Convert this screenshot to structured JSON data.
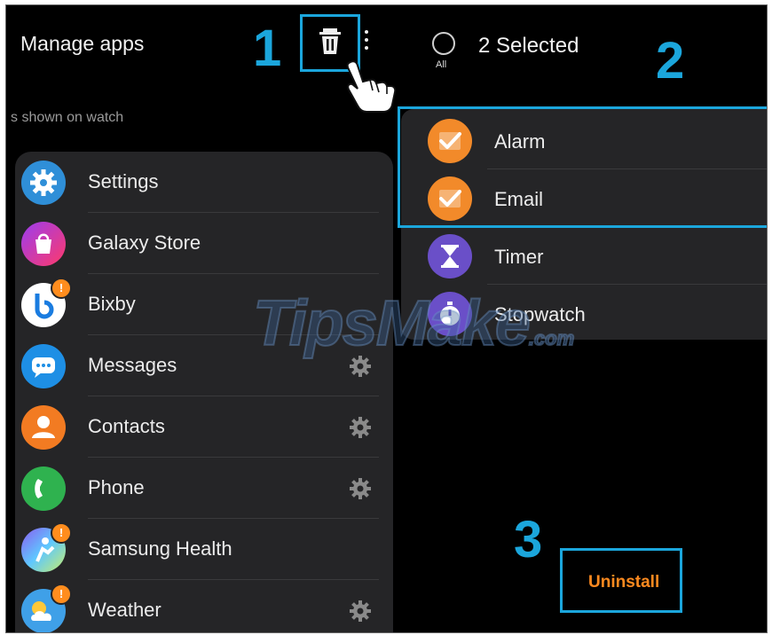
{
  "left_panel": {
    "title": "Manage apps",
    "subtitle": "s shown on watch",
    "apps": [
      {
        "name": "Settings",
        "icon": "settings-icon",
        "color": "#2f8fd8",
        "badge": "",
        "gear": false
      },
      {
        "name": "Galaxy Store",
        "icon": "galaxy-store-icon",
        "color": "#e8336b",
        "badge": "",
        "gear": false
      },
      {
        "name": "Bixby",
        "icon": "bixby-icon",
        "color": "#ffffff",
        "badge": "!",
        "gear": false
      },
      {
        "name": "Messages",
        "icon": "messages-icon",
        "color": "#1e8fe5",
        "badge": "",
        "gear": true
      },
      {
        "name": "Contacts",
        "icon": "contacts-icon",
        "color": "#f27b22",
        "badge": "",
        "gear": true
      },
      {
        "name": "Phone",
        "icon": "phone-icon",
        "color": "#2fb24f",
        "badge": "",
        "gear": true
      },
      {
        "name": "Samsung Health",
        "icon": "samsung-health-icon",
        "color": "#8fc6ff",
        "badge": "!",
        "gear": false
      },
      {
        "name": "Weather",
        "icon": "weather-icon",
        "color": "#3fa0e8",
        "badge": "!",
        "gear": true
      }
    ]
  },
  "right_panel": {
    "all_label": "All",
    "selected_text": "2 Selected",
    "apps": [
      {
        "name": "Alarm",
        "icon": "alarm-icon",
        "color": "#f28a2a",
        "checked": true
      },
      {
        "name": "Email",
        "icon": "email-icon",
        "color": "#f28a2a",
        "checked": true
      },
      {
        "name": "Timer",
        "icon": "timer-icon",
        "color": "#6a4fc8",
        "checked": false
      },
      {
        "name": "Stopwatch",
        "icon": "stopwatch-icon",
        "color": "#6a4fc8",
        "checked": false
      }
    ],
    "uninstall_label": "Uninstall"
  },
  "annotations": {
    "step1": "1",
    "step2": "2",
    "step3": "3",
    "accent": "#1ba6dc"
  },
  "watermark": {
    "text": "TipsMake",
    "suffix": ".com"
  }
}
